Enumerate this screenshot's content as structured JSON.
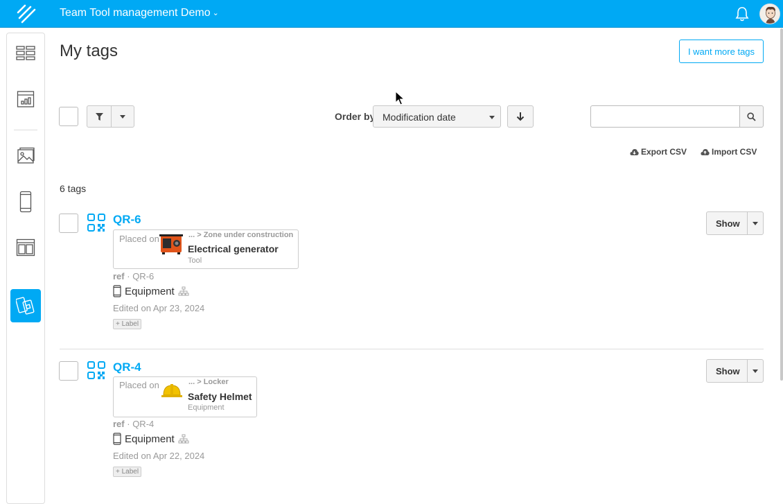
{
  "header": {
    "app_title": "Team Tool management Demo",
    "accent_color": "#00a9f4"
  },
  "sidebar": {
    "items": [
      {
        "icon": "dashboard-icon",
        "active": false
      },
      {
        "icon": "analytics-icon",
        "active": false
      },
      {
        "icon": "gallery-icon",
        "active": false
      },
      {
        "icon": "mobile-icon",
        "active": false
      },
      {
        "icon": "layout-icon",
        "active": false
      },
      {
        "icon": "tags-icon",
        "active": true
      }
    ]
  },
  "page": {
    "title": "My tags",
    "more_tags_button": "I want more tags"
  },
  "toolbar": {
    "order_by_label": "Order by",
    "order_by_value": "Modification date",
    "search_placeholder": "",
    "export_csv": "Export CSV",
    "import_csv": "Import CSV"
  },
  "list": {
    "count_text": "6 tags",
    "tags": [
      {
        "title": "QR-6",
        "placed_on_label": "Placed on",
        "breadcrumb": "... > Zone under construction",
        "object_name": "Electrical generator",
        "object_category": "Tool",
        "ref_label": "ref",
        "ref_value": "· QR-6",
        "type": "Equipment",
        "edited": "Edited on Apr 23, 2024",
        "label_button": "+ Label",
        "show_button": "Show"
      },
      {
        "title": "QR-4",
        "placed_on_label": "Placed on",
        "breadcrumb": "... > Locker",
        "object_name": "Safety Helmet",
        "object_category": "Equipment",
        "ref_label": "ref",
        "ref_value": "· QR-4",
        "type": "Equipment",
        "edited": "Edited on Apr 22, 2024",
        "label_button": "+ Label",
        "show_button": "Show"
      }
    ]
  }
}
